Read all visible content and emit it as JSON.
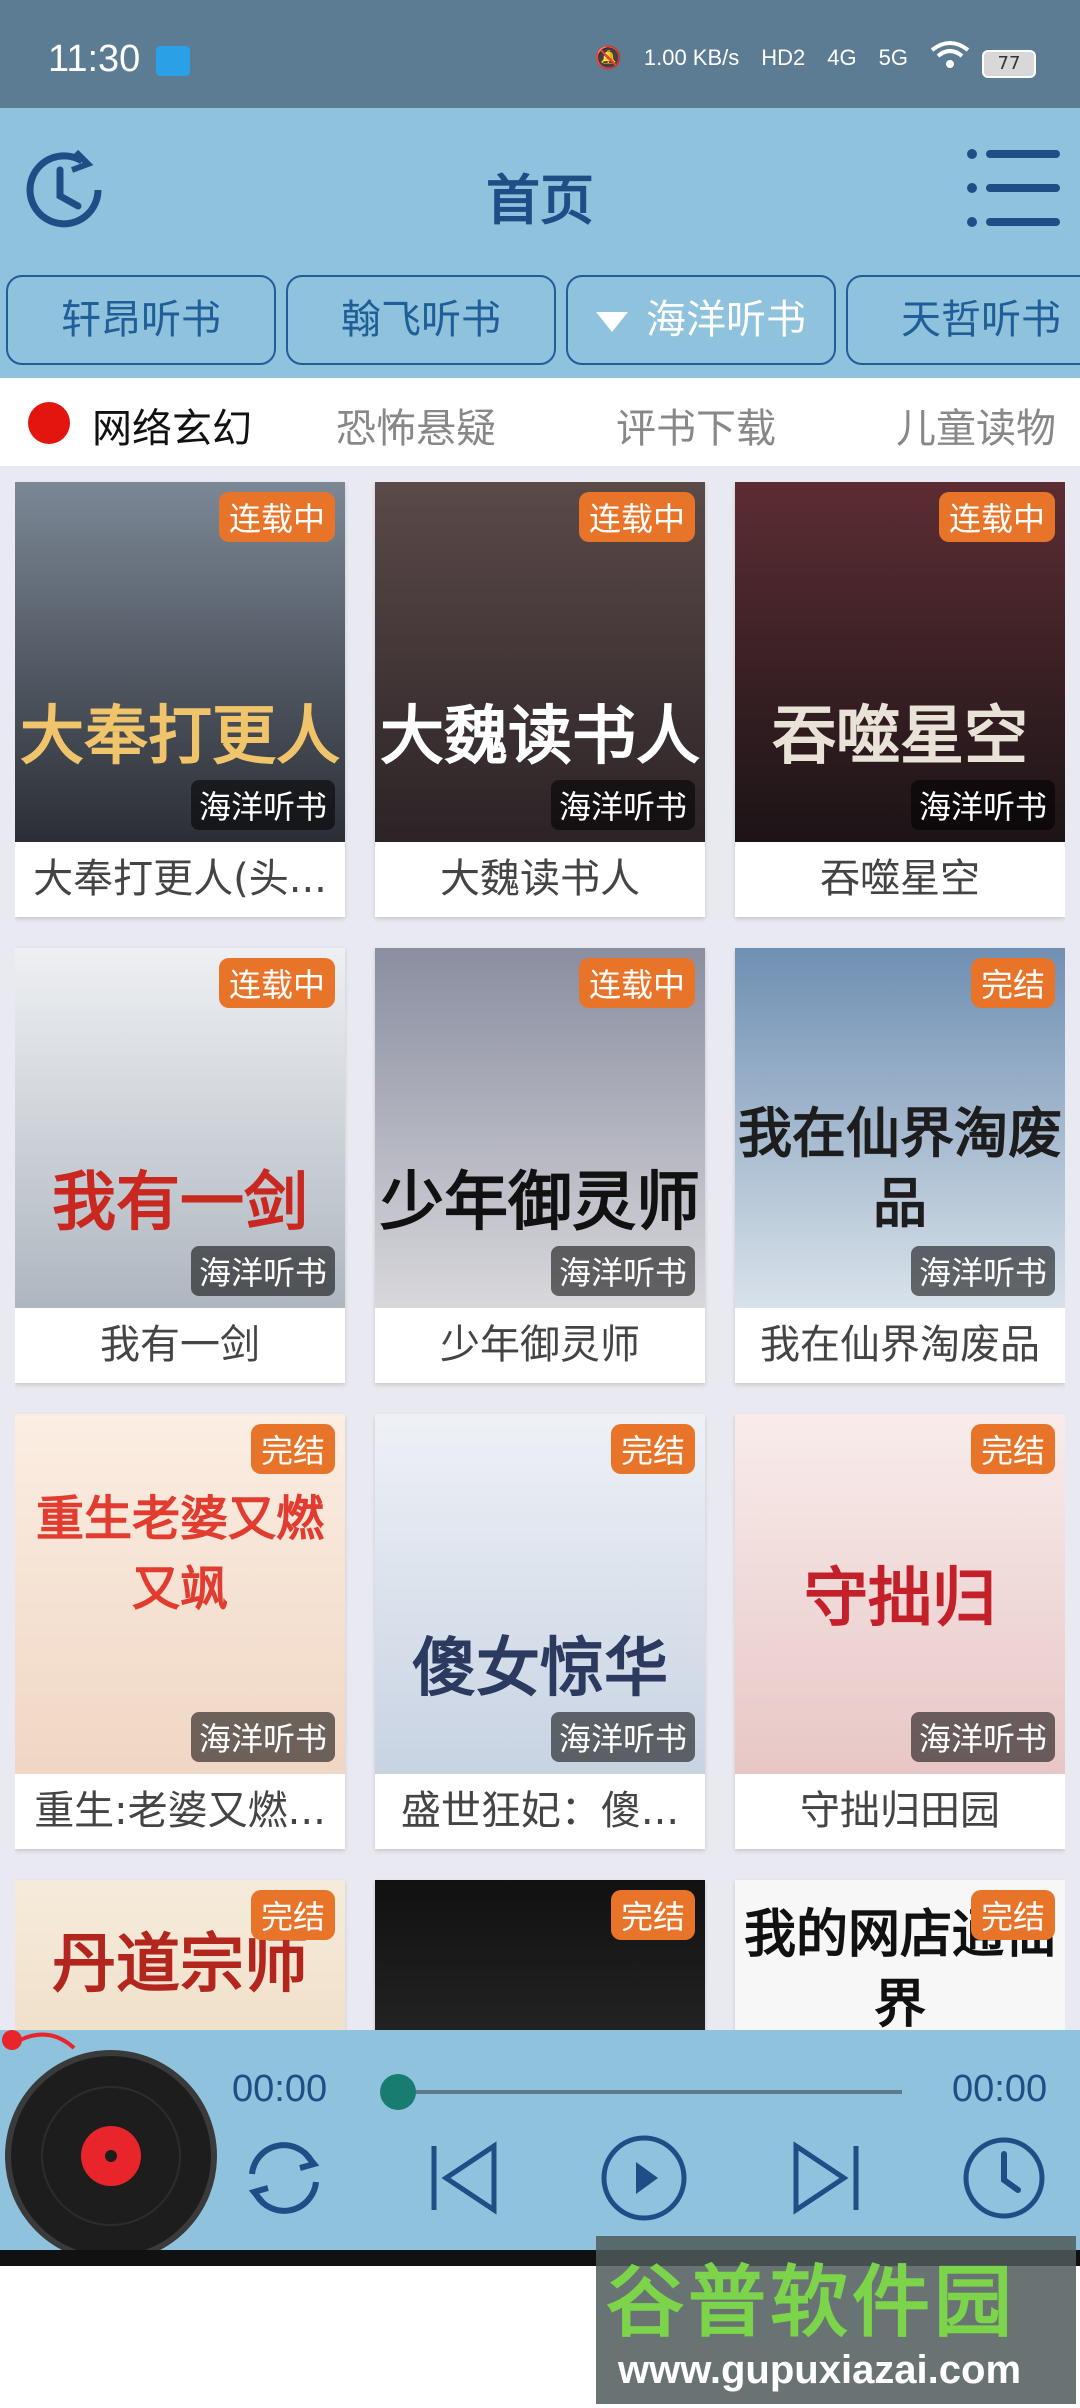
{
  "status": {
    "time": "11:30",
    "speed": "1.00 KB/s",
    "net1": "HD2",
    "net2": "4G",
    "net3": "5G",
    "battery": "77"
  },
  "header": {
    "title": "首页"
  },
  "sources": [
    {
      "label": "轩昂听书"
    },
    {
      "label": "翰飞听书"
    },
    {
      "label": "海洋听书",
      "active": true
    },
    {
      "label": "天哲听书"
    }
  ],
  "categories": [
    {
      "label": "网络玄幻",
      "active": true
    },
    {
      "label": "恐怖悬疑"
    },
    {
      "label": "评书下载"
    },
    {
      "label": "儿童读物"
    }
  ],
  "books": [
    {
      "title": "大奉打更人(头...",
      "badge": "连载中",
      "source": "海洋听书",
      "cover_text": "大奉打更人",
      "cover_bg": "#2b2e35",
      "cover_fg": "#f0c46a"
    },
    {
      "title": "大魏读书人",
      "badge": "连载中",
      "source": "海洋听书",
      "cover_text": "大魏读书人",
      "cover_bg": "#3a3034",
      "cover_fg": "#ffffff"
    },
    {
      "title": "吞噬星空",
      "badge": "连载中",
      "source": "海洋听书",
      "cover_text": "吞噬星空",
      "cover_bg": "#2a1e22",
      "cover_fg": "#e9e2d6"
    },
    {
      "title": "我有一剑",
      "badge": "连载中",
      "source": "海洋听书",
      "cover_text": "我有一剑",
      "cover_bg": "#d9dde3",
      "cover_fg": "#c8281f"
    },
    {
      "title": "少年御灵师",
      "badge": "连载中",
      "source": "海洋听书",
      "cover_text": "少年御灵师",
      "cover_bg": "#4a4e5e",
      "cover_fg": "#111111"
    },
    {
      "title": "我在仙界淘废品",
      "badge": "完结",
      "source": "海洋听书",
      "cover_text": "我在仙界淘废品",
      "cover_bg": "#9ab6cf",
      "cover_fg": "#1d1d1d"
    },
    {
      "title": "重生:老婆又燃...",
      "badge": "完结",
      "source": "海洋听书",
      "cover_text": "重生老婆又燃又飒",
      "cover_bg": "#f6e3d2",
      "cover_fg": "#e23c30"
    },
    {
      "title": "盛世狂妃：傻...",
      "badge": "完结",
      "source": "海洋听书",
      "cover_text": "傻女惊华",
      "cover_bg": "#dfe6ef",
      "cover_fg": "#2b3a5e"
    },
    {
      "title": "守拙归田园",
      "badge": "完结",
      "source": "海洋听书",
      "cover_text": "守拙归",
      "cover_bg": "#f4e9e4",
      "cover_fg": "#c4202a"
    },
    {
      "title": "",
      "badge": "完结",
      "source": "",
      "cover_text": "丹道宗师",
      "cover_bg": "#f3e4d0",
      "cover_fg": "#b3261d"
    },
    {
      "title": "",
      "badge": "完结",
      "source": "",
      "cover_text": "",
      "cover_bg": "#1f1f1f",
      "cover_fg": "#ffffff"
    },
    {
      "title": "",
      "badge": "完结",
      "source": "",
      "cover_text": "我的网店通仙界",
      "cover_bg": "#f7f7f7",
      "cover_fg": "#111111"
    }
  ],
  "player": {
    "current_time": "00:00",
    "total_time": "00:00",
    "progress": 0
  },
  "watermark": {
    "brand": "谷普软件园",
    "url": "www.gupuxiazai.com"
  },
  "colors": {
    "header_bg": "#8ec2dd",
    "accent": "#1f5e97",
    "badge": "#e8742a",
    "status_bg": "#5b7c93"
  }
}
